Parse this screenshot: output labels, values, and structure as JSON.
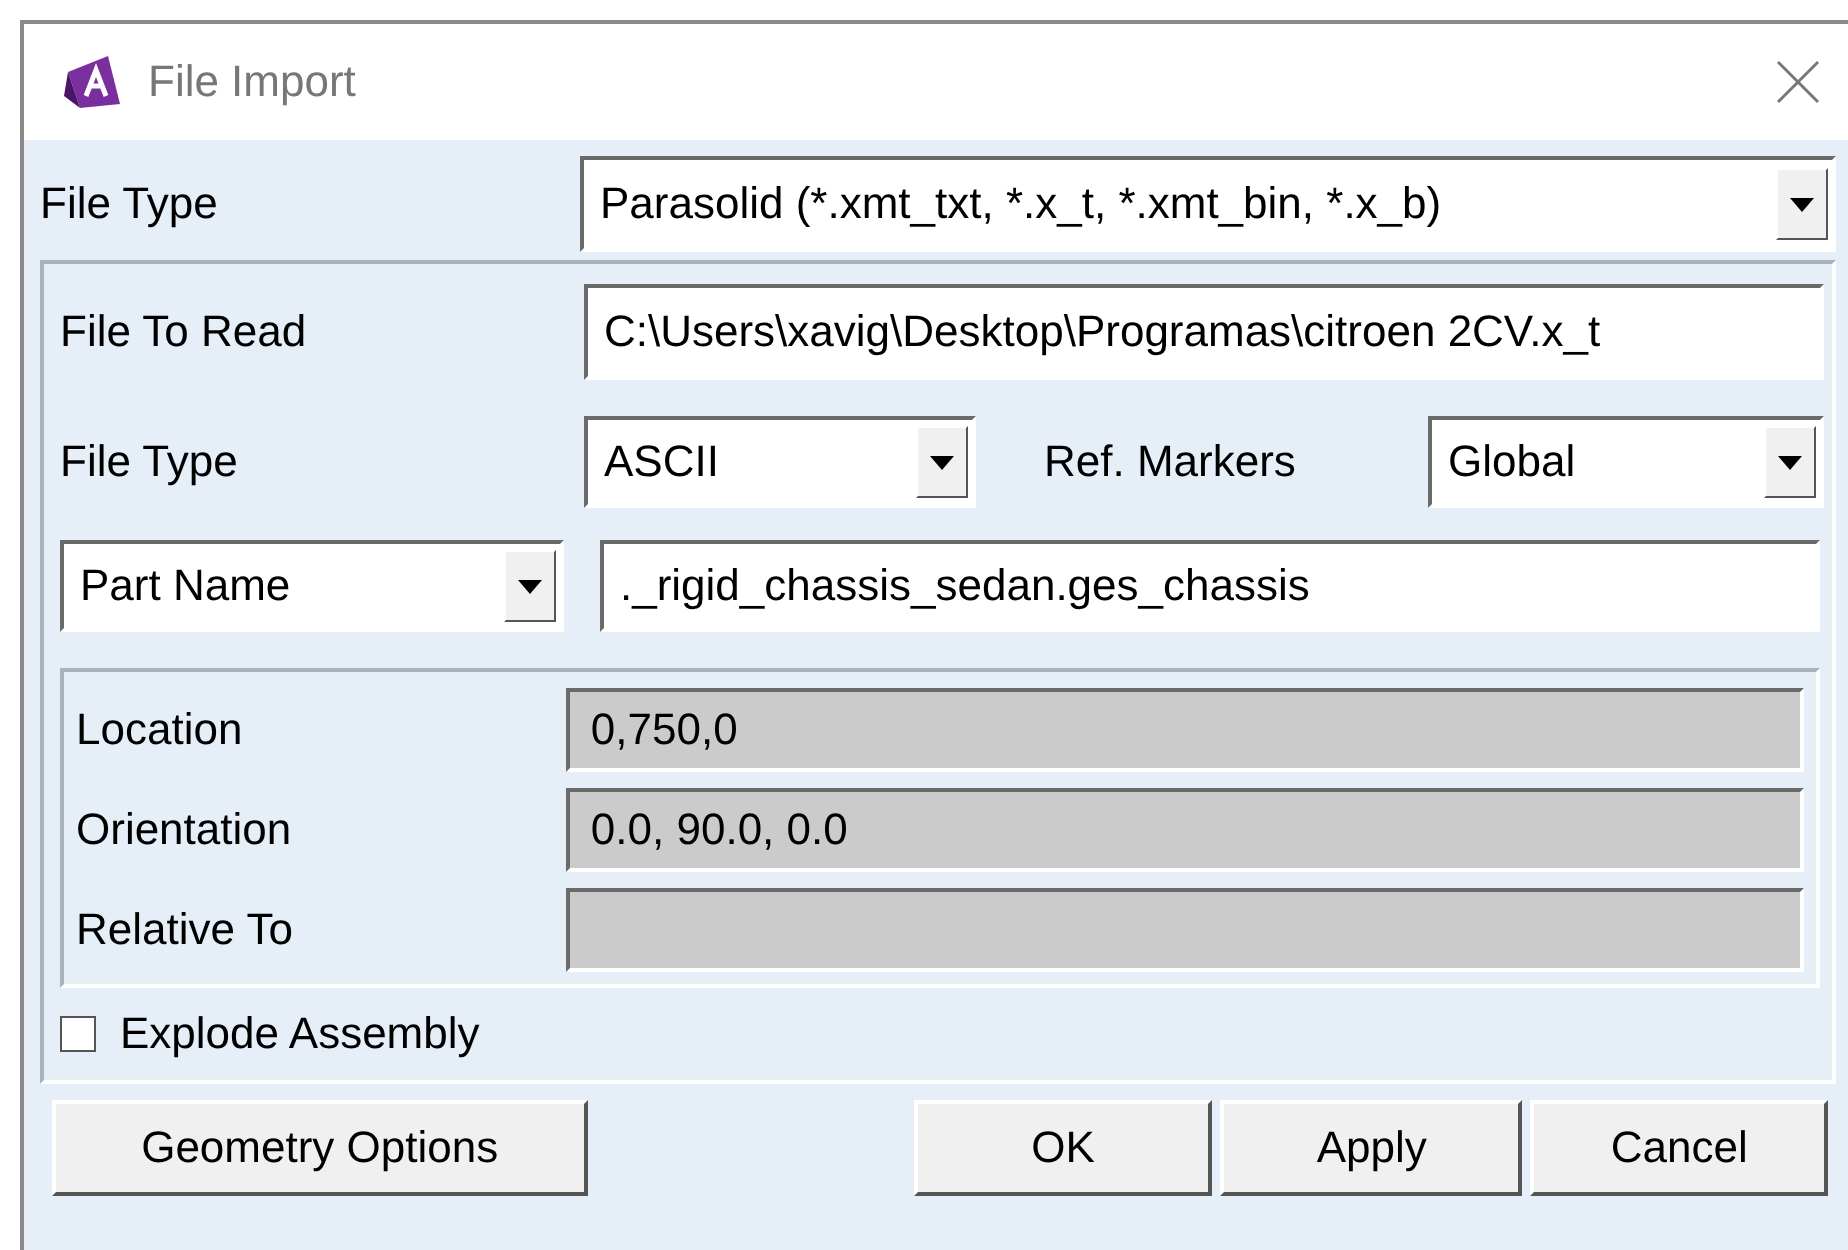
{
  "window": {
    "title": "File Import"
  },
  "file_type": {
    "label": "File Type",
    "value": "Parasolid (*.xmt_txt, *.x_t, *.xmt_bin, *.x_b)"
  },
  "file_to_read": {
    "label": "File To Read",
    "value": "C:\\Users\\xavig\\Desktop\\Programas\\citroen 2CV.x_t"
  },
  "format": {
    "label": "File Type",
    "value": "ASCII"
  },
  "ref_markers": {
    "label": "Ref. Markers",
    "value": "Global"
  },
  "name_kind": {
    "value": "Part Name"
  },
  "name_value": {
    "value": "._rigid_chassis_sedan.ges_chassis"
  },
  "placement": [
    {
      "label": "Location",
      "value": "0,750,0",
      "disabled": true
    },
    {
      "label": "Orientation",
      "value": "0.0, 90.0, 0.0",
      "disabled": true
    },
    {
      "label": "Relative To",
      "disabled": true
    }
  ],
  "explode": {
    "label": "Explode Assembly",
    "checked": false
  },
  "buttons": [
    {
      "label": "Geometry Options"
    },
    {
      "label": "OK"
    },
    {
      "label": "Apply"
    },
    {
      "label": "Cancel"
    }
  ]
}
